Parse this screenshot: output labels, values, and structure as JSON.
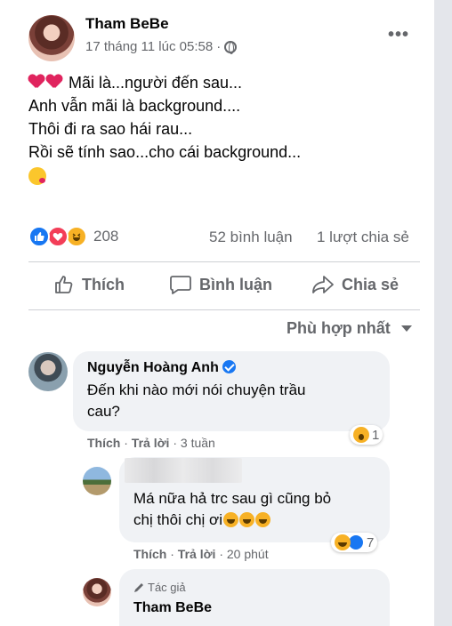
{
  "post": {
    "author": "Tham BeBe",
    "timestamp": "17 tháng 11 lúc 05:58",
    "audience_icon": "globe-icon",
    "more_label": "•••",
    "lines": [
      "Mãi là...người đến sau...",
      "Anh vẫn mãi là background....",
      "Thôi đi ra sao hái rau...",
      "Rồi sẽ tính sao...cho cái background..."
    ],
    "reaction_count": "208",
    "comments_count": "52 bình luận",
    "shares_count": "1 lượt chia sẻ"
  },
  "actions": {
    "like": "Thích",
    "comment": "Bình luận",
    "share": "Chia sẻ"
  },
  "sort_label": "Phù hợp nhất",
  "comments": [
    {
      "name": "Nguyễn Hoàng Anh",
      "verified": true,
      "lines": [
        "Đến khi nào mới nói chuyện trầu",
        "cau?"
      ],
      "like": "Thích",
      "reply": "Trả lời",
      "time": "3 tuần",
      "reaction_count": "1"
    },
    {
      "name": "",
      "lines": [
        "Má nữa hả trc sau gì cũng bỏ",
        "chị thôi chị ơi"
      ],
      "like": "Thích",
      "reply": "Trả lời",
      "time": "20 phút",
      "reaction_count": "7"
    },
    {
      "author_tag": "Tác giả",
      "name": "Tham BeBe"
    }
  ],
  "colors": {
    "brand_blue": "#1877f2",
    "secondary_text": "#65676b",
    "bubble_bg": "#f0f2f5"
  }
}
